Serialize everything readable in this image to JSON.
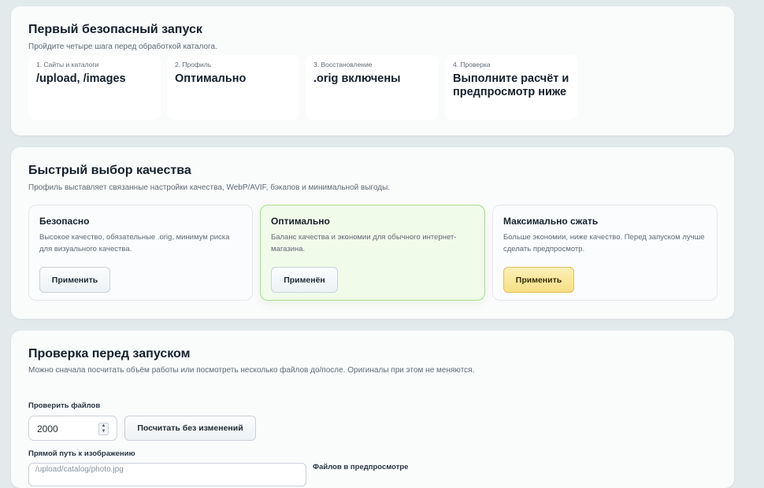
{
  "launch": {
    "title": "Первый безопасный запуск",
    "subtitle": "Пройдите четыре шага перед обработкой каталога.",
    "steps": [
      {
        "label": "1. Сайты и каталоги",
        "value": "/upload, /images"
      },
      {
        "label": "2. Профиль",
        "value": "Оптимально"
      },
      {
        "label": "3. Восстановление",
        "value": ".orig включены"
      },
      {
        "label": "4. Проверка",
        "value": "Выполните расчёт и предпросмотр ниже"
      }
    ]
  },
  "quality": {
    "title": "Быстрый выбор качества",
    "subtitle": "Профиль выставляет связанные настройки качества, WebP/AVIF, бэкапов и минимальной выгоды.",
    "cards": [
      {
        "title": "Безопасно",
        "description": "Высокое качество, обязательные .orig, минимум риска для визуального качества.",
        "button": "Применить"
      },
      {
        "title": "Оптимально",
        "description": "Баланс качества и экономии для обычного интернет-магазина.",
        "button": "Применён"
      },
      {
        "title": "Максимально сжать",
        "description": "Больше экономии, ниже качество. Перед запуском лучше сделать предпросмотр.",
        "button": "Применить"
      }
    ],
    "colors": {
      "active_bg": "#f1fbea",
      "active_border": "#a9de8f",
      "accent_button": "#f6df85"
    }
  },
  "check": {
    "title": "Проверка перед запуском",
    "subtitle": "Можно сначала посчитать объём работы или посмотреть несколько файлов до/после. Оригиналы при этом не меняются.",
    "files_label": "Проверить файлов",
    "files_value": "2000",
    "count_button": "Посчитать без изменений",
    "path_label": "Прямой путь к изображению",
    "path_placeholder": "/upload/catalog/photo.jpg",
    "preview_label": "Файлов в предпросмотре"
  }
}
